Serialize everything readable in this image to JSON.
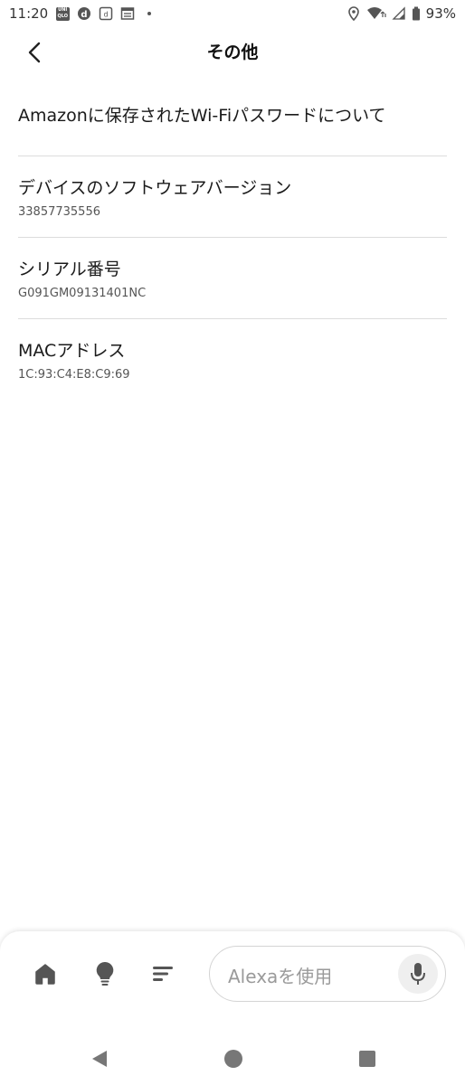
{
  "status_bar": {
    "time": "11:20",
    "battery": "93%",
    "icons": [
      "uniqlo-icon",
      "d-icon",
      "d-square-icon",
      "news-icon",
      "dot-icon",
      "location-icon",
      "wifi-icon",
      "signal-icon",
      "battery-icon"
    ]
  },
  "header": {
    "title": "その他",
    "back_icon": "chevron-left-icon"
  },
  "items": [
    {
      "title": "Amazonに保存されたWi-Fiパスワードについて"
    },
    {
      "title": "デバイスのソフトウェアバージョン",
      "value": "33857735556"
    },
    {
      "title": "シリアル番号",
      "value": "G091GM09131401NC"
    },
    {
      "title": "MACアドレス",
      "value": "1C:93:C4:E8:C9:69"
    }
  ],
  "bottom_nav": {
    "icons": [
      "home-icon",
      "lightbulb-icon",
      "list-icon"
    ],
    "alexa_placeholder": "Alexaを使用",
    "mic_icon": "microphone-icon"
  },
  "system_nav": {
    "icons": [
      "back-triangle-icon",
      "home-circle-icon",
      "recents-square-icon"
    ]
  },
  "colors": {
    "icon_gray": "#555555",
    "divider": "#dcdcdc",
    "placeholder": "#9a9a9a"
  }
}
